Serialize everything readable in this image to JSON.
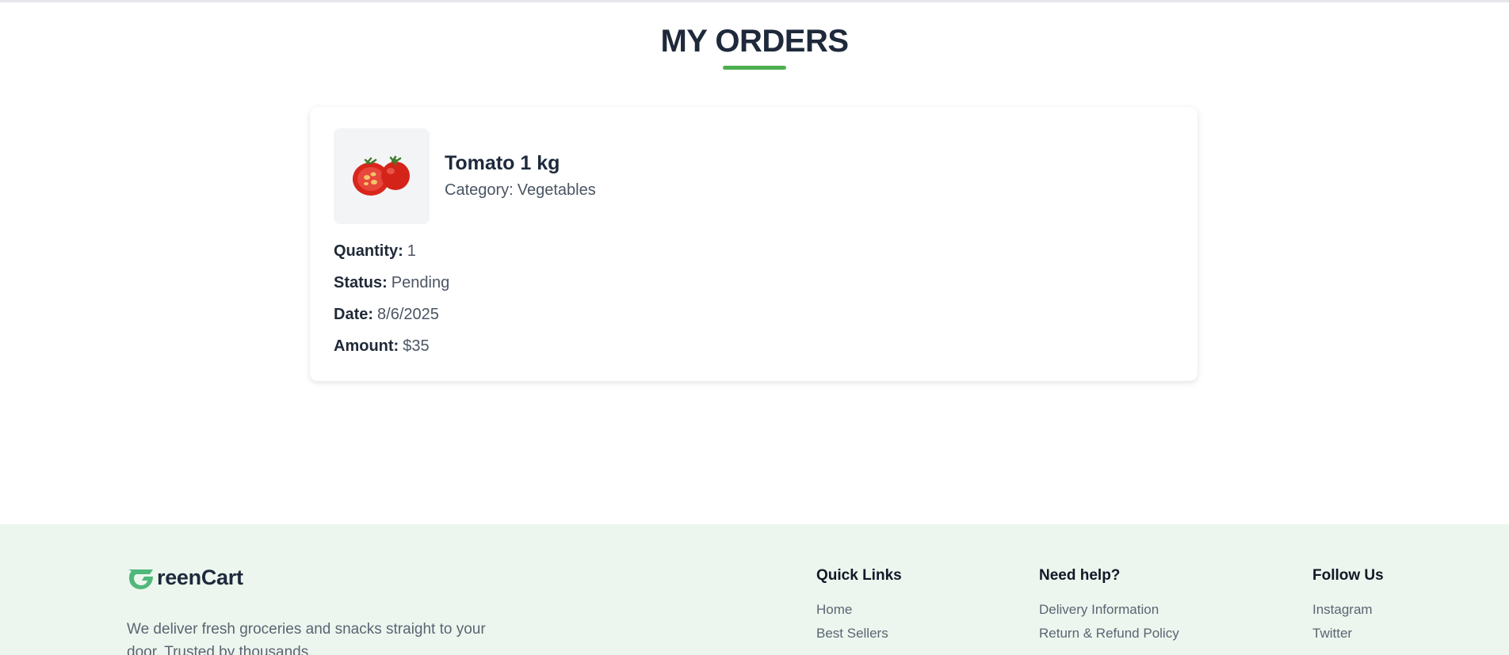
{
  "page": {
    "title": "MY ORDERS",
    "accent": "#4caf50"
  },
  "order": {
    "product_name": "Tomato 1 kg",
    "category_label": "Category:",
    "category_value": "Vegetables",
    "image_icon": "tomato-icon",
    "details": [
      {
        "label": "Quantity:",
        "value": "1"
      },
      {
        "label": "Status:",
        "value": "Pending"
      },
      {
        "label": "Date:",
        "value": "8/6/2025"
      },
      {
        "label": "Amount:",
        "value": "$35"
      }
    ]
  },
  "footer": {
    "brand_text": "reenCart",
    "brand_color": "#4fb87a",
    "tagline": "We deliver fresh groceries and snacks straight to your door. Trusted by thousands,",
    "columns": [
      {
        "title": "Quick Links",
        "links": [
          "Home",
          "Best Sellers"
        ]
      },
      {
        "title": "Need help?",
        "links": [
          "Delivery Information",
          "Return & Refund Policy"
        ]
      },
      {
        "title": "Follow Us",
        "links": [
          "Instagram",
          "Twitter"
        ]
      }
    ]
  }
}
